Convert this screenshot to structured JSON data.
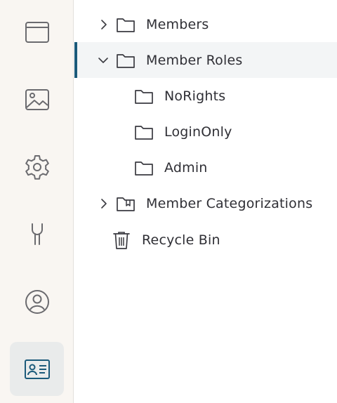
{
  "rail": {
    "items": [
      {
        "icon": "browser-window-icon",
        "active": false
      },
      {
        "icon": "image-icon",
        "active": false
      },
      {
        "icon": "gear-icon",
        "active": false
      },
      {
        "icon": "wrench-icon",
        "active": false
      },
      {
        "icon": "user-circle-icon",
        "active": false
      },
      {
        "icon": "id-card-icon",
        "active": true
      }
    ],
    "accent": "#1b5a7a"
  },
  "tree": {
    "items": [
      {
        "label": "Members",
        "icon": "folder-icon",
        "expander": "collapsed"
      },
      {
        "label": "Member Roles",
        "icon": "folder-icon",
        "expander": "expanded",
        "selected": true
      },
      {
        "label": "NoRights",
        "icon": "folder-icon"
      },
      {
        "label": "LoginOnly",
        "icon": "folder-icon"
      },
      {
        "label": "Admin",
        "icon": "folder-icon"
      },
      {
        "label": "Member Categorizations",
        "icon": "folder-bookmark-icon",
        "expander": "collapsed"
      },
      {
        "label": "Recycle Bin",
        "icon": "trash-icon"
      }
    ]
  }
}
